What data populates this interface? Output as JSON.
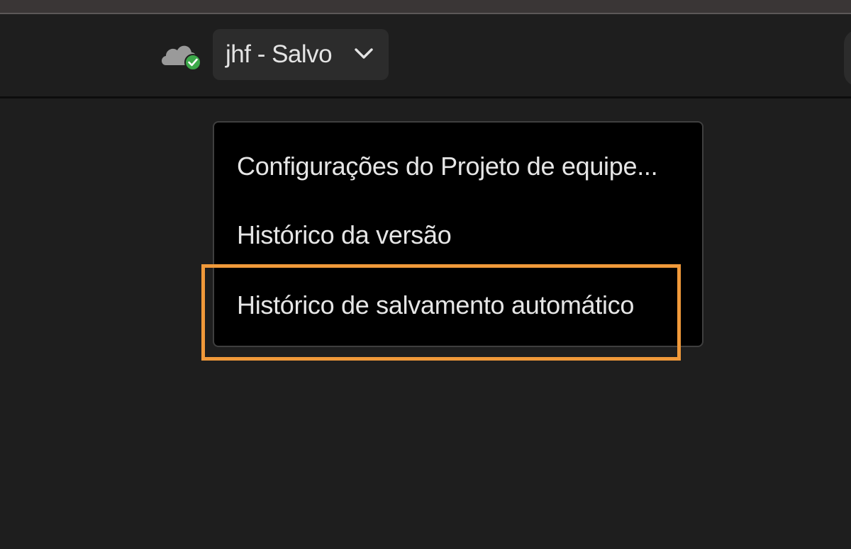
{
  "header": {
    "cloud_status_icon": "cloud-synced-icon",
    "project_button": {
      "label": "jhf - Salvo",
      "icon": "chevron-down-icon"
    }
  },
  "dropdown": {
    "items": [
      {
        "label": "Configurações do Projeto de equipe..."
      },
      {
        "label": "Histórico da versão"
      },
      {
        "label": "Histórico de salvamento automático"
      }
    ]
  },
  "highlight": {
    "color": "#f0993a",
    "target": "Histórico de salvamento automático"
  },
  "colors": {
    "background": "#1e1e1e",
    "menu_background": "#000000",
    "button_background": "#2c2c2c",
    "status_ok": "#3ca84a"
  }
}
